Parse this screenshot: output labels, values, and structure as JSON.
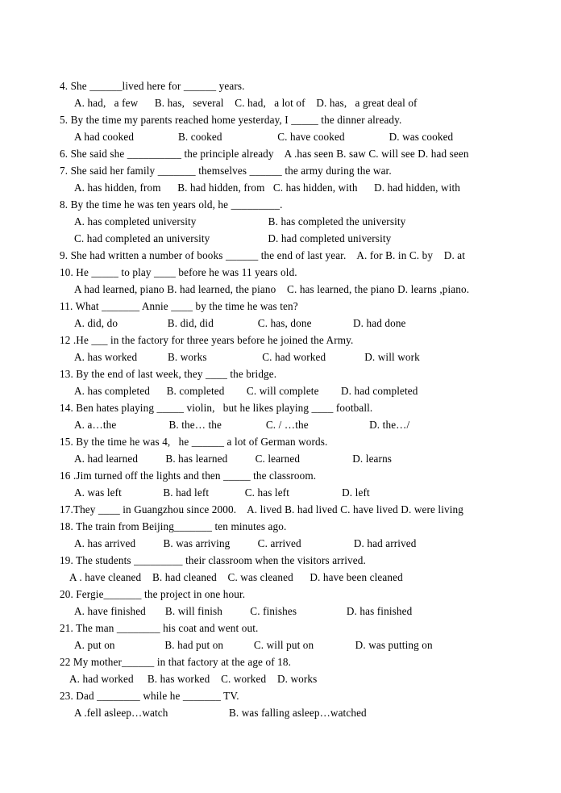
{
  "document": {
    "type": "grammar-worksheet",
    "page_background": "#ffffff",
    "text_color": "#000000",
    "lines": [
      {
        "id": "q4-stem",
        "kind": "stem",
        "text": "4. She ______lived here for ______ years."
      },
      {
        "id": "q4-opts",
        "kind": "opts",
        "text": "A. had,   a few      B. has,   several    C. had,   a lot of    D. has,   a great deal of"
      },
      {
        "id": "q5-stem",
        "kind": "stem",
        "text": "5. By the time my parents reached home yesterday, I _____ the dinner already."
      },
      {
        "id": "q5-opts",
        "kind": "opts",
        "text": "A had cooked                B. cooked                    C. have cooked                D. was cooked"
      },
      {
        "id": "q6-stem",
        "kind": "stem",
        "text": "6. She said she __________ the principle already    A .has seen B. saw C. will see D. had seen"
      },
      {
        "id": "q7-stem",
        "kind": "stem",
        "text": "7. She said her family _______ themselves ______ the army during the war."
      },
      {
        "id": "q7-opts",
        "kind": "opts",
        "text": "A. has hidden, from      B. had hidden, from   C. has hidden, with      D. had hidden, with"
      },
      {
        "id": "q8-stem",
        "kind": "stem",
        "text": "8. By the time he was ten years old, he _________."
      },
      {
        "id": "q8-optsA",
        "kind": "opts",
        "text": "A. has completed university                          B. has completed the university"
      },
      {
        "id": "q8-optsC",
        "kind": "opts",
        "text": "C. had completed an university                     D. had completed university"
      },
      {
        "id": "q9-stem",
        "kind": "stem",
        "text": "9. She had written a number of books ______ the end of last year.    A. for B. in C. by    D. at"
      },
      {
        "id": "q10-stem",
        "kind": "stem",
        "text": "10. He _____ to play ____ before he was 11 years old."
      },
      {
        "id": "q10-opts",
        "kind": "opts",
        "text": "A had learned, piano B. had learned, the piano    C. has learned, the piano D. learns ,piano."
      },
      {
        "id": "q11-stem",
        "kind": "stem",
        "text": "11. What _______ Annie ____ by the time he was ten?"
      },
      {
        "id": "q11-opts",
        "kind": "opts",
        "text": "A. did, do                  B. did, did                C. has, done               D. had done"
      },
      {
        "id": "q12-stem",
        "kind": "stem",
        "text": "12 .He ___ in the factory for three years before he joined the Army."
      },
      {
        "id": "q12-opts",
        "kind": "opts",
        "text": "A. has worked           B. works                    C. had worked              D. will work"
      },
      {
        "id": "q13-stem",
        "kind": "stem",
        "text": "13. By the end of last week, they ____ the bridge."
      },
      {
        "id": "q13-opts",
        "kind": "opts",
        "text": "A. has completed      B. completed        C. will complete        D. had completed"
      },
      {
        "id": "q14-stem",
        "kind": "stem",
        "text": "14. Ben hates playing _____ violin,   but he likes playing ____ football."
      },
      {
        "id": "q14-opts",
        "kind": "opts",
        "text": "A. a…the                   B. the… the                C. / …the                      D. the…/"
      },
      {
        "id": "q15-stem",
        "kind": "stem",
        "text": "15. By the time he was 4,   he ______ a lot of German words."
      },
      {
        "id": "q15-opts",
        "kind": "opts",
        "text": "A. had learned          B. has learned          C. learned                   D. learns"
      },
      {
        "id": "q16-stem",
        "kind": "stem",
        "text": "16 .Jim turned off the lights and then _____ the classroom."
      },
      {
        "id": "q16-opts",
        "kind": "opts",
        "text": "A. was left               B. had left             C. has left                   D. left"
      },
      {
        "id": "q17-stem",
        "kind": "stem",
        "text": "17.They ____ in Guangzhou since 2000.    A. lived B. had lived C. have lived D. were living"
      },
      {
        "id": "q18-stem",
        "kind": "stem",
        "text": "18. The train from Beijing_______ ten minutes ago."
      },
      {
        "id": "q18-opts",
        "kind": "opts",
        "text": "A. has arrived          B. was arriving          C. arrived                   D. had arrived"
      },
      {
        "id": "q19-stem",
        "kind": "stem",
        "text": "19. The students _________ their classroom when the visitors arrived."
      },
      {
        "id": "q19-opts",
        "kind": "opts",
        "text": "A . have cleaned    B. had cleaned    C. was cleaned      D. have been cleaned"
      },
      {
        "id": "q20-stem",
        "kind": "stem",
        "text": "20. Fergie_______ the project in one hour."
      },
      {
        "id": "q20-opts",
        "kind": "opts",
        "text": "A. have finished       B. will finish          C. finishes                  D. has finished"
      },
      {
        "id": "q21-stem",
        "kind": "stem",
        "text": "21. The man ________ his coat and went out."
      },
      {
        "id": "q21-opts",
        "kind": "opts",
        "text": "A. put on                  B. had put on           C. will put on               D. was putting on"
      },
      {
        "id": "q22-stem",
        "kind": "stem",
        "text": "22 My mother______ in that factory at the age of 18."
      },
      {
        "id": "q22-opts",
        "kind": "opts",
        "text": "A. had worked     B. has worked    C. worked    D. works"
      },
      {
        "id": "q23-stem",
        "kind": "stem",
        "text": "23. Dad ________ while he _______ TV."
      },
      {
        "id": "q23-opts",
        "kind": "opts",
        "text": "A .fell asleep…watch                      B. was falling asleep…watched"
      }
    ]
  }
}
